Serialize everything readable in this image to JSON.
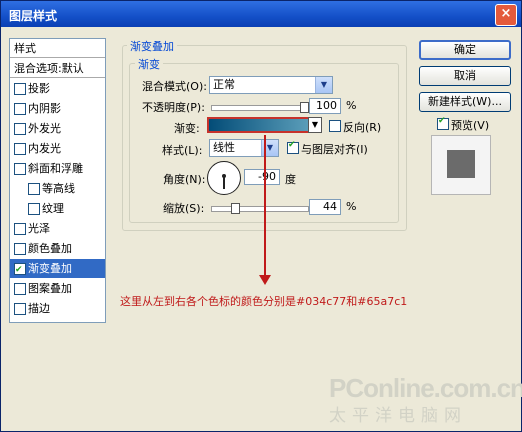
{
  "window": {
    "title": "图层样式",
    "close_icon": "×"
  },
  "sidebar": {
    "header": "样式",
    "blend_options": "混合选项:默认",
    "items": [
      {
        "label": "投影",
        "checked": false
      },
      {
        "label": "内阴影",
        "checked": false
      },
      {
        "label": "外发光",
        "checked": false
      },
      {
        "label": "内发光",
        "checked": false
      },
      {
        "label": "斜面和浮雕",
        "checked": false
      },
      {
        "label": "等高线",
        "checked": false
      },
      {
        "label": "纹理",
        "checked": false
      },
      {
        "label": "光泽",
        "checked": false
      },
      {
        "label": "颜色叠加",
        "checked": false
      },
      {
        "label": "渐变叠加",
        "checked": true,
        "selected": true
      },
      {
        "label": "图案叠加",
        "checked": false
      },
      {
        "label": "描边",
        "checked": false
      }
    ]
  },
  "panel": {
    "group_title": "渐变叠加",
    "subgroup_title": "渐变",
    "blend_mode_label": "混合模式(O):",
    "blend_mode_value": "正常",
    "opacity_label": "不透明度(P):",
    "opacity_value": "100",
    "opacity_unit": "%",
    "opacity_level": 1.0,
    "gradient_label": "渐变:",
    "gradient_colors": [
      "#034c77",
      "#65a7c1"
    ],
    "reverse_label": "反向(R)",
    "reverse_checked": false,
    "style_label": "样式(L):",
    "style_value": "线性",
    "align_label": "与图层对齐(I)",
    "align_checked": true,
    "angle_label": "角度(N):",
    "angle_value": "-90",
    "angle_unit": "度",
    "scale_label": "缩放(S):",
    "scale_value": "44",
    "scale_unit": "%",
    "scale_level": 0.44
  },
  "buttons": {
    "ok": "确定",
    "cancel": "取消",
    "new_style": "新建样式(W)...",
    "preview_label": "预览(V)",
    "preview_checked": true
  },
  "annotation": "这里从左到右各个色标的颜色分别是#034c77和#65a7c1",
  "watermark": {
    "line1": "PConline.com.cn",
    "line2": "太平洋电脑网"
  },
  "colors": {
    "accent_red": "#c01a1a",
    "selection": "#316ac5",
    "gradient_start": "#034c77",
    "gradient_end": "#65a7c1"
  }
}
